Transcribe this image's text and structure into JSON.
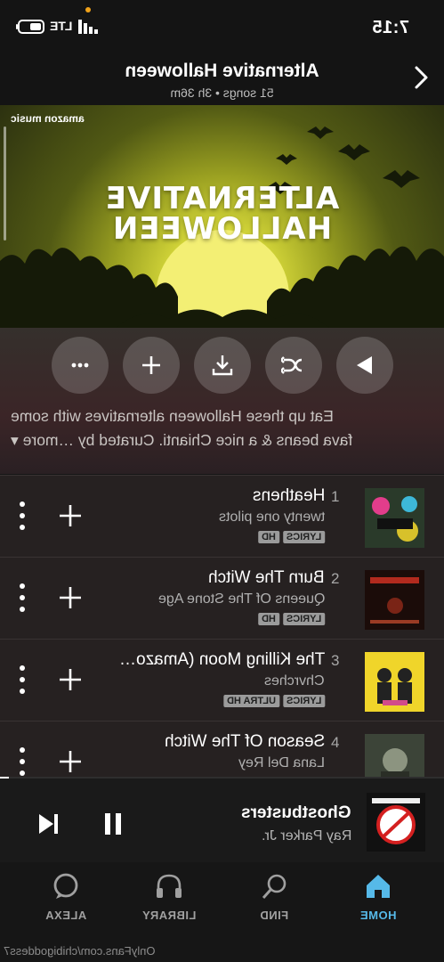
{
  "status_bar": {
    "time": "7:15",
    "network": "LTE",
    "icons": [
      "signal-icon",
      "battery-icon"
    ]
  },
  "header": {
    "title": "Alternative Halloween",
    "subtitle": "51 songs • 3h 36m",
    "icon": "chevron-right-icon"
  },
  "artwork": {
    "title_line1": "ALTERNATIVE",
    "title_line2": "HALLOWEEN",
    "brand": "amazon music"
  },
  "controls": {
    "icons": [
      "play-icon",
      "shuffle-icon",
      "download-icon",
      "add-icon",
      "more-icon"
    ]
  },
  "description": {
    "line1": "Eat up these Halloween alternatives with some",
    "line2": "fava beans & a nice Chianti. Curated by …more ▾"
  },
  "tracks": [
    {
      "number": "1",
      "title": "Heathens",
      "artist": "twenty one pilots",
      "badges": [
        "HD",
        "LYRICS"
      ]
    },
    {
      "number": "2",
      "title": "Burn The Witch",
      "artist": "Queens Of The Stone Age",
      "badges": [
        "HD",
        "LYRICS"
      ]
    },
    {
      "number": "3",
      "title": "The Killing Moon (Amazo…",
      "artist": "Chvrches",
      "badges": [
        "ULTRA HD",
        "LYRICS"
      ]
    },
    {
      "number": "4",
      "title": "Season Of The Witch",
      "artist": "Lana Del Rey",
      "badges": []
    }
  ],
  "now_playing": {
    "title": "Ghostbusters",
    "artist": "Ray Parker Jr.",
    "progress_fraction": 0.02
  },
  "nav": [
    {
      "label": "HOME",
      "icon": "home-icon",
      "active": true
    },
    {
      "label": "FIND",
      "icon": "search-icon",
      "active": false
    },
    {
      "label": "LIBRARY",
      "icon": "headphones-icon",
      "active": false
    },
    {
      "label": "ALEXA",
      "icon": "alexa-icon",
      "active": false
    }
  ],
  "watermark": "OnlyFans.com/chibigoddess7",
  "colors": {
    "accent": "#56b9e8",
    "background": "#141414",
    "artwork_yellow": "#d6d83a"
  }
}
